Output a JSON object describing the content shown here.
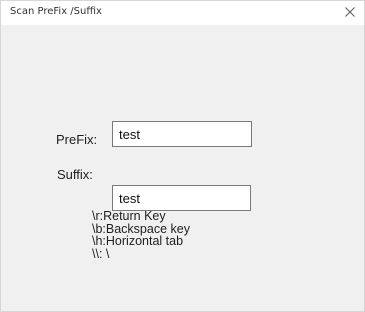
{
  "window": {
    "title": "Scan PreFix /Suffix"
  },
  "prefix": {
    "label": "PreFix:",
    "value": "test"
  },
  "suffix": {
    "label": "Suffix:",
    "value": "test"
  },
  "help": {
    "lines": [
      "\\r:Return Key",
      "\\b:Backspace key",
      "\\h:Horizontal tab",
      "\\\\: \\"
    ]
  },
  "icons": {
    "close": "close-icon"
  },
  "colors": {
    "background": "#f0f0f0",
    "titlebar": "#ffffff",
    "input_border": "#7a7a7a"
  }
}
